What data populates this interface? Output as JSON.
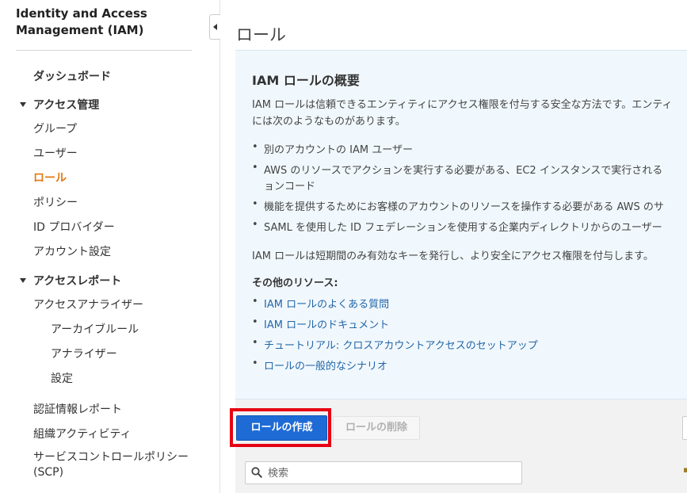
{
  "sidebar": {
    "title_line1": "Identity and Access",
    "title_line2": "Management (IAM)",
    "dashboard": "ダッシュボード",
    "access_mgmt": {
      "label": "アクセス管理",
      "items": [
        "グループ",
        "ユーザー",
        "ロール",
        "ポリシー",
        "ID プロバイダー",
        "アカウント設定"
      ]
    },
    "access_reports": {
      "label": "アクセスレポート",
      "analyzer": "アクセスアナライザー",
      "analyzer_children": [
        "アーカイブルール",
        "アナライザー",
        "設定"
      ]
    },
    "credential_report": "認証情報レポート",
    "org_activity": "組織アクティビティ",
    "scp_line1": "サービスコントロールポリシー",
    "scp_line2": "(SCP)"
  },
  "page": {
    "title": "ロール"
  },
  "info": {
    "title": "IAM ロールの概要",
    "intro_line1": "IAM ロールは信頼できるエンティティにアクセス権限を付与する安全な方法です。エンティ",
    "intro_line2": "には次のようなものがあります。",
    "bullets": [
      "別のアカウントの IAM ユーザー",
      "AWS のリソースでアクションを実行する必要がある、EC2 インスタンスで実行される",
      "ョンコード",
      "機能を提供するためにお客様のアカウントのリソースを操作する必要がある AWS のサ",
      "SAML を使用した ID フェデレーションを使用する企業内ディレクトリからのユーザー"
    ],
    "short_term": "IAM ロールは短期間のみ有効なキーを発行し、より安全にアクセス権限を付与します。",
    "resources_title": "その他のリソース:",
    "links": [
      "IAM ロールのよくある質問",
      "IAM ロールのドキュメント",
      "チュートリアル: クロスアカウントアクセスのセットアップ",
      "ロールの一般的なシナリオ"
    ]
  },
  "actions": {
    "create_label": "ロールの作成",
    "delete_label": "ロールの削除"
  },
  "search": {
    "placeholder": "検索"
  },
  "colors": {
    "active_nav": "#e47911",
    "primary_button": "#1e6bd6",
    "highlight": "#e60012",
    "link": "#2366a8",
    "info_bg": "#f1f8fd"
  }
}
